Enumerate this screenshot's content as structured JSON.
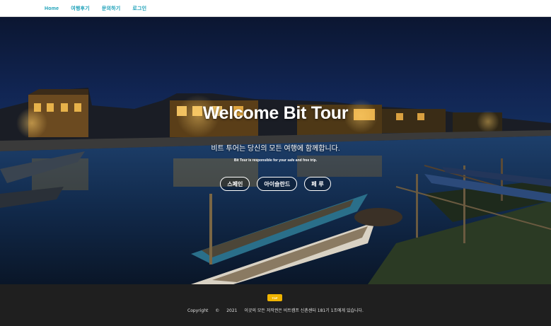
{
  "nav": {
    "items": [
      {
        "label": "Home"
      },
      {
        "label": "여행후기"
      },
      {
        "label": "문의하기"
      },
      {
        "label": "로그인"
      }
    ]
  },
  "hero": {
    "title": "Welcome Bit Tour",
    "subtitle": "비트 투어는 당신의 모든 여행에 함께합니다.",
    "note": "Bit Tour is responsible for your safe and free trip.",
    "buttons": [
      {
        "label": "스페인"
      },
      {
        "label": "아이슬란드"
      },
      {
        "label": "페 루"
      }
    ]
  },
  "footer": {
    "top_label": "TOP",
    "copyright_label": "Copyright",
    "copyright_symbol": "©",
    "year": "2021",
    "rights_text": "이곳의 모든 저작권은 비트캠프 신촌센터 181기 1조에게 있습니다."
  },
  "colors": {
    "nav_link": "#1aa0b8",
    "footer_bg": "#1f1f1f",
    "top_button": "#f0b400"
  }
}
